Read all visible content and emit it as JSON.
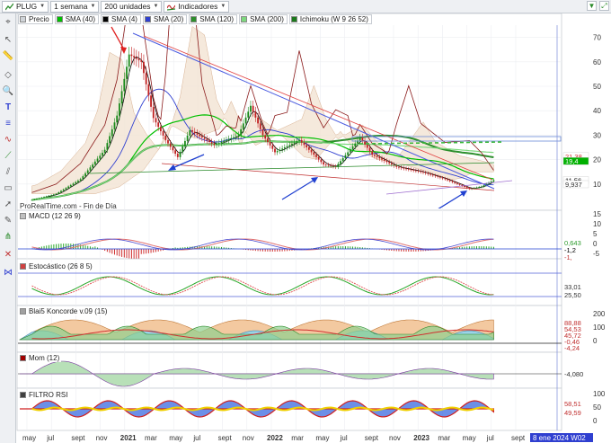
{
  "toolbar": {
    "symbol": "PLUG",
    "period": "1 semana",
    "units": "200 unidades",
    "indicators": "Indicadores"
  },
  "legend": [
    {
      "label": "Precio",
      "color": "#d0d4d8"
    },
    {
      "label": "SMA (40)",
      "color": "#00c000"
    },
    {
      "label": "SMA (4)",
      "color": "#000000"
    },
    {
      "label": "SMA (20)",
      "color": "#2f3fd0"
    },
    {
      "label": "SMA (120)",
      "color": "#2d8f2d"
    },
    {
      "label": "SMA (200)",
      "color": "#7ed87e"
    },
    {
      "label": "Ichimoku (W 9 26 52)",
      "color": "#1c7a1c"
    }
  ],
  "provider_note": "ProRealTime.com - Fin de Día",
  "panels": {
    "macd": {
      "label": "MACD (12 26 9)",
      "color": "#c0c0c0"
    },
    "stoch": {
      "label": "Estocástico (26 8 5)",
      "color": "#d04040"
    },
    "koncorde": {
      "label": "Blai5 Koncorde v.09 (15)",
      "color": "#a0a0a0"
    },
    "mom": {
      "label": "Mom (12)",
      "color": "#a00000"
    },
    "rsi": {
      "label": "FILTRO RSI",
      "color": "#404040"
    }
  },
  "price_axis": [
    "70",
    "60",
    "50",
    "40",
    "30",
    "20",
    "10"
  ],
  "price_tags": [
    {
      "text": "21,38",
      "color": "#d03030",
      "bg": "#ffffff",
      "value": 21.38
    },
    {
      "text": "19,4",
      "color": "#ffffff",
      "bg": "#00b000",
      "value": 19.4
    },
    {
      "text": "11,56",
      "color": "#000000",
      "bg": "#ffffff",
      "value": 11.56
    },
    {
      "text": "9,937",
      "color": "#333333",
      "bg": "#ffffff",
      "value": 9.937
    }
  ],
  "macd_axis": [
    "15",
    "10",
    "5",
    "0",
    "-5"
  ],
  "macd_tags": [
    {
      "text": "0,643",
      "color": "#2a9a2a"
    },
    {
      "text": "-1,2",
      "color": "#000"
    },
    {
      "text": "-1,",
      "color": "#c03030"
    }
  ],
  "stoch_tags": [
    {
      "text": "33,01"
    },
    {
      "text": "25,50"
    }
  ],
  "koncorde_axis": [
    "200",
    "100",
    "0"
  ],
  "koncorde_tags": [
    {
      "text": "88,88"
    },
    {
      "text": "54,53"
    },
    {
      "text": "45,72"
    },
    {
      "text": "-0,46"
    },
    {
      "text": "-4,24"
    }
  ],
  "mom_tags": [
    {
      "text": "-4,080"
    }
  ],
  "rsi_axis": [
    "100",
    "50",
    "0"
  ],
  "rsi_tags": [
    {
      "text": "58,51"
    },
    {
      "text": "49,59"
    }
  ],
  "time_axis": [
    "may",
    "jul",
    "sept",
    "nov",
    "2021",
    "mar",
    "may",
    "jul",
    "sept",
    "nov",
    "2022",
    "mar",
    "may",
    "jul",
    "sept",
    "nov",
    "2023",
    "mar",
    "may",
    "jul",
    "sept"
  ],
  "date_cursor": "8 ene 2024 W02",
  "chart_data": {
    "type": "candlestick",
    "timeframe": "weekly",
    "y_axis_ticks": [
      10,
      20,
      30,
      40,
      50,
      60,
      70
    ],
    "ylim": [
      0,
      75
    ],
    "close_path": [
      {
        "t": "2020-05",
        "v": 3.5
      },
      {
        "t": "2020-07",
        "v": 6
      },
      {
        "t": "2020-09",
        "v": 12
      },
      {
        "t": "2020-11",
        "v": 24
      },
      {
        "t": "2020-12",
        "v": 38
      },
      {
        "t": "2021-01",
        "v": 63
      },
      {
        "t": "2021-02",
        "v": 60
      },
      {
        "t": "2021-03",
        "v": 37
      },
      {
        "t": "2021-04",
        "v": 28
      },
      {
        "t": "2021-05",
        "v": 21
      },
      {
        "t": "2021-06",
        "v": 32
      },
      {
        "t": "2021-08",
        "v": 26
      },
      {
        "t": "2021-10",
        "v": 30
      },
      {
        "t": "2021-11",
        "v": 42
      },
      {
        "t": "2021-12",
        "v": 30
      },
      {
        "t": "2022-01",
        "v": 23
      },
      {
        "t": "2022-03",
        "v": 28
      },
      {
        "t": "2022-05",
        "v": 18
      },
      {
        "t": "2022-06",
        "v": 17
      },
      {
        "t": "2022-08",
        "v": 29
      },
      {
        "t": "2022-09",
        "v": 22
      },
      {
        "t": "2022-11",
        "v": 17
      },
      {
        "t": "2023-01",
        "v": 15
      },
      {
        "t": "2023-03",
        "v": 12
      },
      {
        "t": "2023-05",
        "v": 8
      },
      {
        "t": "2023-06",
        "v": 9
      },
      {
        "t": "2023-07",
        "v": 11.56
      }
    ]
  }
}
